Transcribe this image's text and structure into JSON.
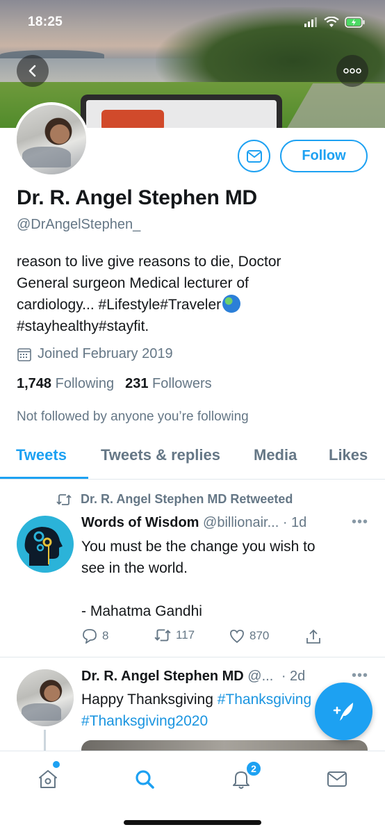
{
  "status_bar": {
    "time": "18:25"
  },
  "profile": {
    "name": "Dr. R. Angel Stephen MD",
    "handle": "@DrAngelStephen_",
    "bio_line1": "reason to live give reasons to die, Doctor",
    "bio_line2": "General surgeon Medical lecturer of",
    "bio_line3": "cardiology... #Lifestyle#Traveler",
    "bio_line4": "#stayhealthy#stayfit.",
    "joined": "Joined February 2019",
    "following_count": "1,748",
    "following_label": "Following",
    "followers_count": "231",
    "followers_label": "Followers",
    "not_followed": "Not followed by anyone you’re following",
    "follow_label": "Follow"
  },
  "tabs": [
    {
      "label": "Tweets",
      "active": true
    },
    {
      "label": "Tweets & replies"
    },
    {
      "label": "Media"
    },
    {
      "label": "Likes"
    }
  ],
  "tweets": [
    {
      "retweet_text": "Dr. R. Angel Stephen MD Retweeted",
      "name": "Words of Wisdom",
      "handle": "@billionair...",
      "time": "· 1d",
      "text_line1": "You must be the change you wish to",
      "text_line2": "see in the world.",
      "text_line3": "-  Mahatma Gandhi",
      "replies": "8",
      "retweets": "117",
      "likes": "870"
    },
    {
      "name": "Dr. R. Angel Stephen MD",
      "handle": "@...",
      "time": "· 2d",
      "text_start": "Happy Thanksgiving ",
      "hashtag1": "#Thanksgiving",
      "hashtag2": "#Thanksgiving2020"
    }
  ],
  "bottom_nav": {
    "notifications_badge": "2"
  },
  "colors": {
    "accent": "#1da1f2",
    "text": "#14171a",
    "muted": "#657786",
    "divider": "#e1e8ed"
  },
  "icons": [
    "back-arrow-icon",
    "more-icon",
    "mail-icon",
    "calendar-icon",
    "retweet-icon",
    "reply-icon",
    "like-icon",
    "share-icon",
    "compose-icon",
    "home-icon",
    "search-icon",
    "bell-icon"
  ]
}
